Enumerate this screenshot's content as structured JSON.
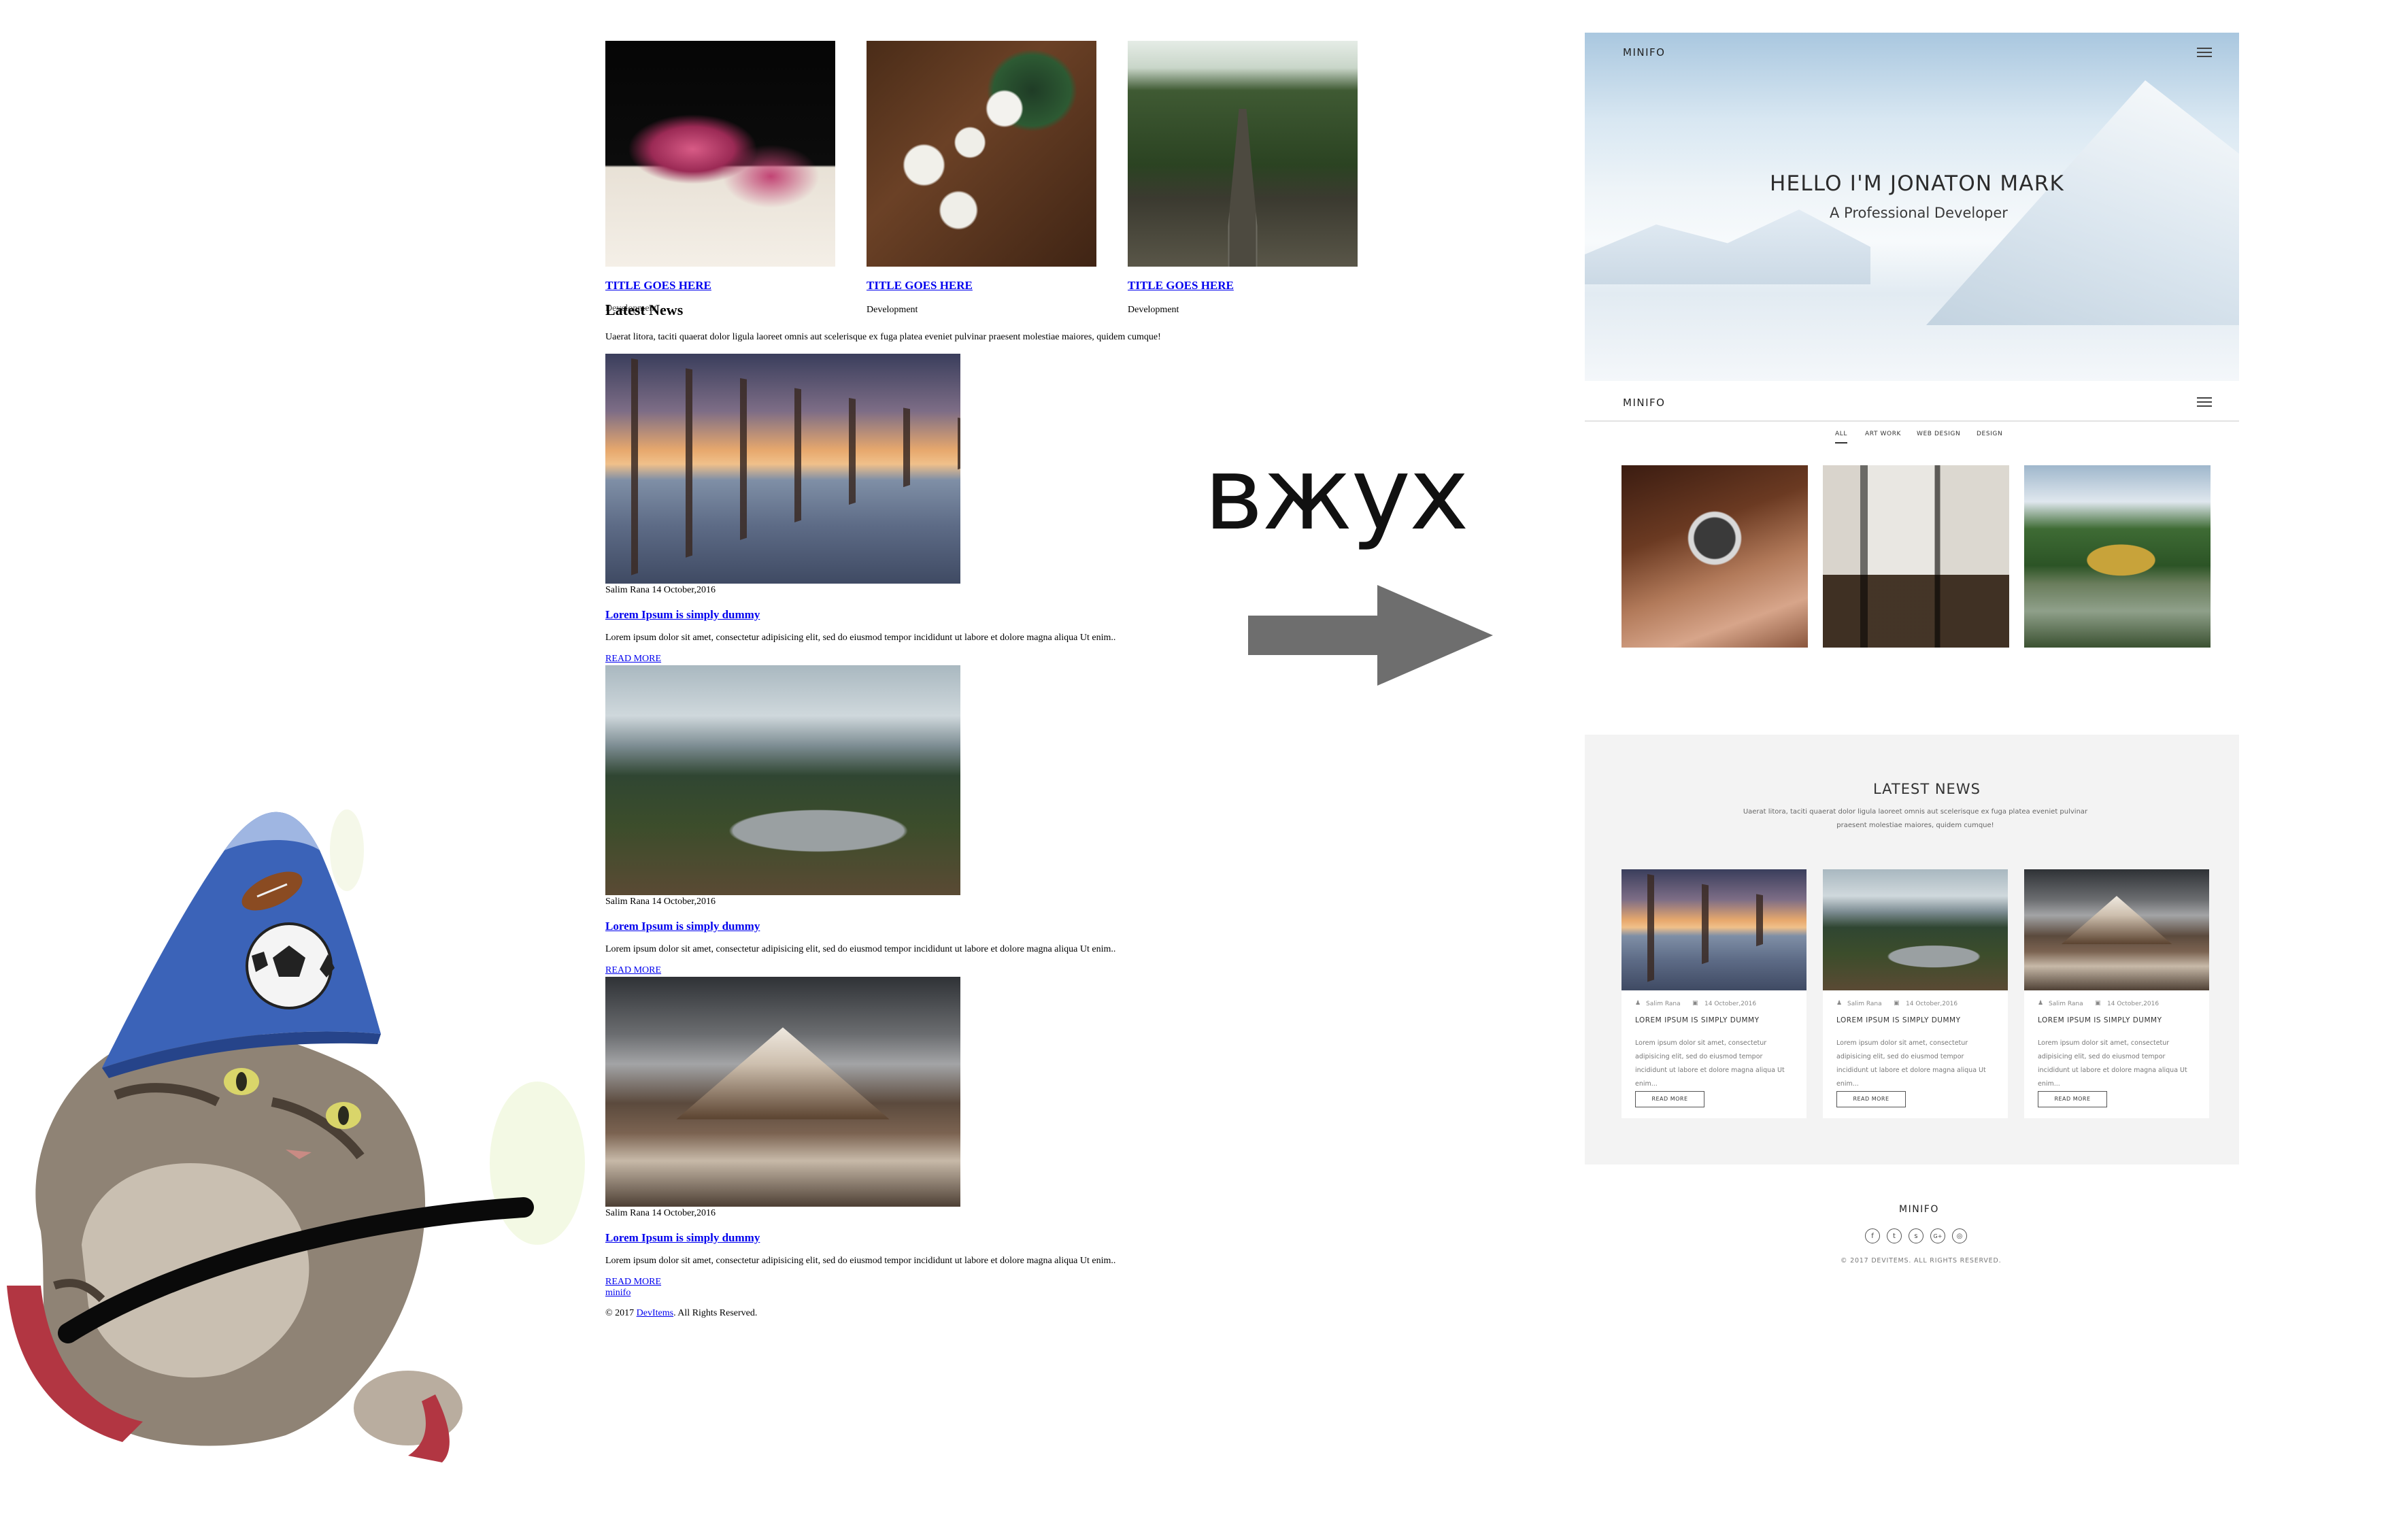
{
  "meme": {
    "caption": "вжух",
    "cat_description_icon": "wizard-cat-icon"
  },
  "before_page": {
    "portfolio": [
      {
        "title": "TITLE GOES HERE",
        "category": "Development"
      },
      {
        "title": "TITLE GOES HERE",
        "category": "Development"
      },
      {
        "title": "TITLE GOES HERE",
        "category": "Development"
      }
    ],
    "first_category_overlap": "Development",
    "news_heading": "Latest News",
    "news_intro": "Uaerat litora, taciti quaerat dolor ligula laoreet omnis aut scelerisque ex fuga platea eveniet pulvinar praesent molestiae maiores, quidem cumque!",
    "posts": [
      {
        "meta": "Salim Rana 14 October,2016",
        "title": "Lorem Ipsum is simply dummy",
        "body": "Lorem ipsum dolor sit amet, consectetur adipisicing elit, sed do eiusmod tempor incididunt ut labore et dolore magna aliqua Ut enim..",
        "read_more": "READ MORE"
      },
      {
        "meta": "Salim Rana 14 October,2016",
        "title": "Lorem Ipsum is simply dummy",
        "body": "Lorem ipsum dolor sit amet, consectetur adipisicing elit, sed do eiusmod tempor incididunt ut labore et dolore magna aliqua Ut enim..",
        "read_more": "READ MORE"
      },
      {
        "meta": "Salim Rana 14 October,2016",
        "title": "Lorem Ipsum is simply dummy",
        "body": "Lorem ipsum dolor sit amet, consectetur adipisicing elit, sed do eiusmod tempor incididunt ut labore et dolore magna aliqua Ut enim..",
        "read_more": "READ MORE"
      }
    ],
    "footer_link": "minifo",
    "copyright_prefix": "© 2017 ",
    "copyright_link": "DevItems",
    "copyright_suffix": ". All Rights Reserved."
  },
  "after_page": {
    "brand": "MINIFO",
    "hero_title": "HELLO I'M JONATON MARK",
    "hero_subtitle": "A Professional Developer",
    "filters": [
      "ALL",
      "ART WORK",
      "WEB DESIGN",
      "DESIGN"
    ],
    "news_heading": "LATEST NEWS",
    "news_intro": "Uaerat litora, taciti quaerat dolor ligula laoreet omnis aut scelerisque ex fuga platea eveniet pulvinar praesent molestiae maiores, quidem cumque!",
    "cards": [
      {
        "author": "Salim Rana",
        "date": "14 October,2016",
        "title": "LOREM IPSUM IS SIMPLY DUMMY",
        "body": "Lorem ipsum dolor sit amet, consectetur adipisicing elit, sed do eiusmod tempor incididunt ut labore et dolore magna aliqua Ut enim...",
        "button": "READ MORE"
      },
      {
        "author": "Salim Rana",
        "date": "14 October,2016",
        "title": "LOREM IPSUM IS SIMPLY DUMMY",
        "body": "Lorem ipsum dolor sit amet, consectetur adipisicing elit, sed do eiusmod tempor incididunt ut labore et dolore magna aliqua Ut enim...",
        "button": "READ MORE"
      },
      {
        "author": "Salim Rana",
        "date": "14 October,2016",
        "title": "LOREM IPSUM IS SIMPLY DUMMY",
        "body": "Lorem ipsum dolor sit amet, consectetur adipisicing elit, sed do eiusmod tempor incididunt ut labore et dolore magna aliqua Ut enim...",
        "button": "READ MORE"
      }
    ],
    "footer_brand": "MINIFO",
    "social_icons": [
      "facebook-icon",
      "twitter-icon",
      "skype-icon",
      "google-plus-icon",
      "dribbble-icon"
    ],
    "social_glyphs": [
      "f",
      "t",
      "s",
      "G+",
      "◎"
    ],
    "copyright": "© 2017 DEVITEMS. ALL RIGHTS RESERVED."
  },
  "colors": {
    "link_blue": "#0000ee",
    "arrow_gray": "#6e6e6e",
    "news_band": "#f3f3f3"
  }
}
